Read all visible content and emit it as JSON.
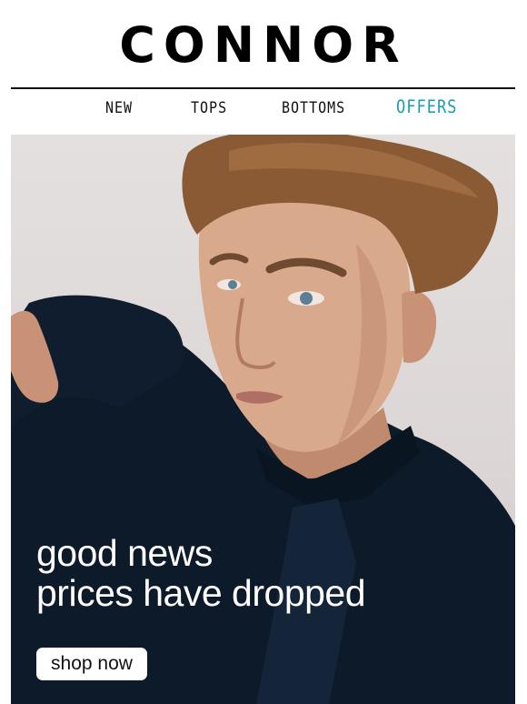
{
  "brand": {
    "logo_text": "CONNOR"
  },
  "nav": {
    "items": [
      {
        "label": "NEW"
      },
      {
        "label": "TOPS"
      },
      {
        "label": "BOTTOMS"
      },
      {
        "label": "OFFERS",
        "color": "#1e9db3"
      }
    ]
  },
  "hero": {
    "headline_line1": "good news",
    "headline_line2": "prices have dropped",
    "cta_label": "shop now"
  },
  "colors": {
    "text": "#111111",
    "accent": "#1e9db3",
    "shirt": "#0d1a2a",
    "hair": "#8a5a34",
    "skin": "#d9a98c",
    "backdrop": "#e0dbda"
  }
}
